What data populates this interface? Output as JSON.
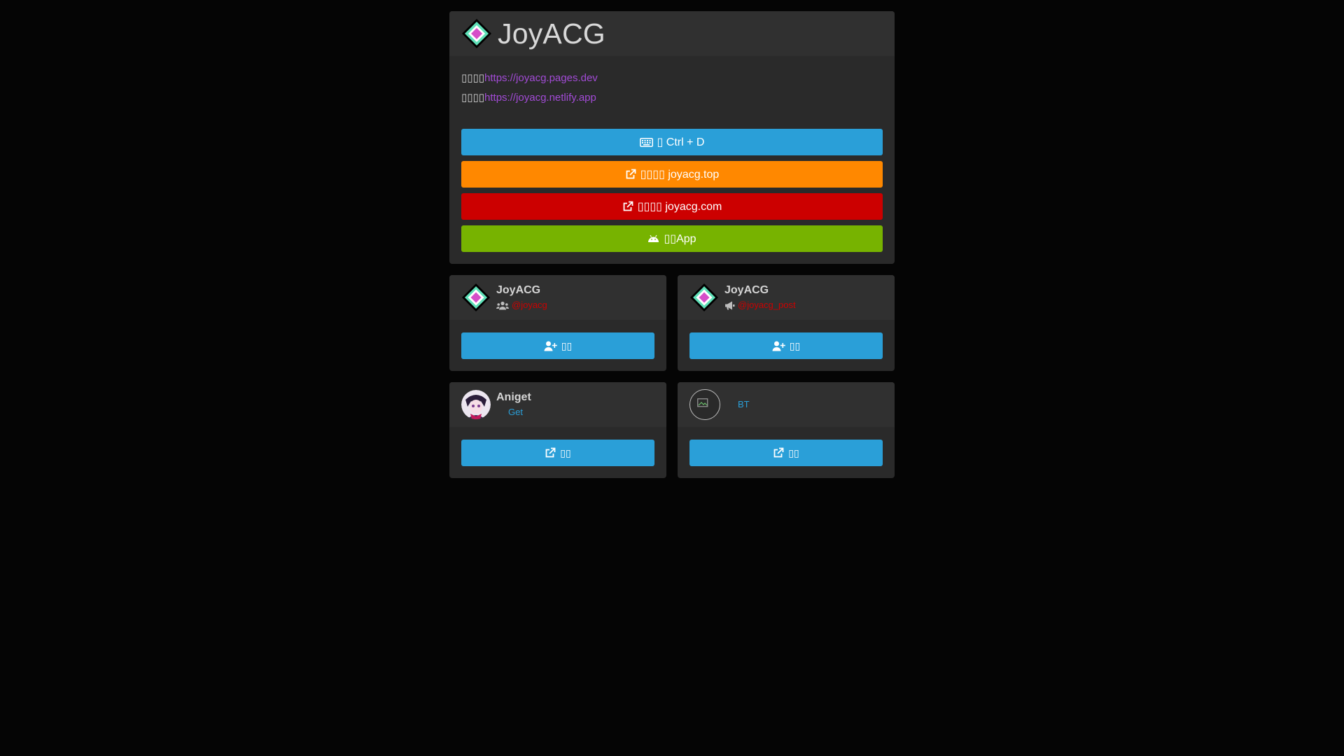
{
  "header": {
    "title": "JoyACG",
    "logo_icon": "diamond-logo-icon"
  },
  "links": [
    {
      "prefix": "▯▯▯▯",
      "url": "https://joyacg.pages.dev"
    },
    {
      "prefix": "▯▯▯▯",
      "url": "https://joyacg.netlify.app"
    }
  ],
  "buttons": [
    {
      "label": "▯ Ctrl + D",
      "icon": "keyboard-icon",
      "color": "#2a9fd8"
    },
    {
      "label": "▯▯▯▯ joyacg.top",
      "icon": "external-link-icon",
      "color": "#ff8800"
    },
    {
      "label": "▯▯▯▯ joyacg.com",
      "icon": "external-link-icon",
      "color": "#cc0000"
    },
    {
      "label": "▯▯App",
      "icon": "android-icon",
      "color": "#77b300"
    }
  ],
  "cards": [
    {
      "name": "JoyACG",
      "sub_icon": "users-icon",
      "handle": "@joyacg",
      "button_label": "▯▯",
      "button_icon": "user-plus-icon"
    },
    {
      "name": "JoyACG",
      "sub_icon": "bullhorn-icon",
      "handle": "@joyacg_post",
      "button_label": "▯▯",
      "button_icon": "user-plus-icon"
    },
    {
      "name": "Aniget",
      "sub_text": "Get",
      "button_label": "▯▯",
      "button_icon": "external-link-icon"
    },
    {
      "name": "",
      "sub_text": "BT",
      "button_label": "▯▯",
      "button_icon": "external-link-icon"
    }
  ],
  "colors": {
    "page_bg": "#050505",
    "card_bg": "#2a2a2a",
    "link": "#a24bd6",
    "blue": "#2a9fd8",
    "orange": "#ff8800",
    "red": "#cc0000",
    "green": "#77b300"
  }
}
